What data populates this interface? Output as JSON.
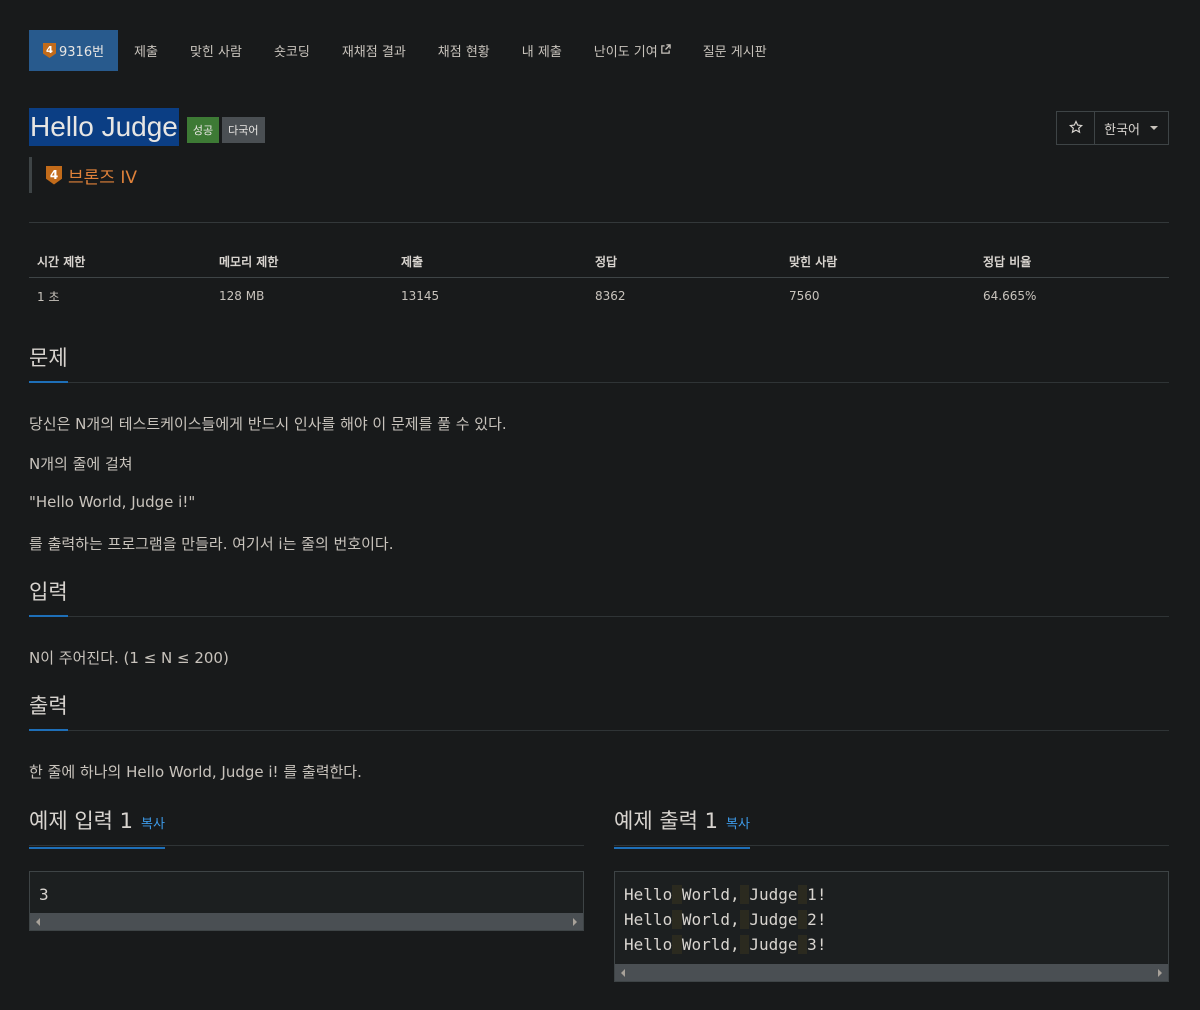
{
  "nav": {
    "problem_tier": "4",
    "problem_id": "9316번",
    "items": [
      "제출",
      "맞힌 사람",
      "숏코딩",
      "재채점 결과",
      "채점 현황",
      "내 제출",
      "난이도 기여",
      "질문 게시판"
    ]
  },
  "problem": {
    "title": "Hello Judge",
    "labels": [
      "성공",
      "다국어"
    ],
    "tier_number": "4",
    "tier_text": "브론즈 IV",
    "language": "한국어"
  },
  "stats": {
    "headers": [
      "시간 제한",
      "메모리 제한",
      "제출",
      "정답",
      "맞힌 사람",
      "정답 비율"
    ],
    "values": [
      "1 초",
      "128 MB",
      "13145",
      "8362",
      "7560",
      "64.665%"
    ]
  },
  "sections": {
    "description": {
      "heading": "문제",
      "lines": [
        "당신은 N개의 테스트케이스들에게 반드시 인사를 해야 이 문제를 풀 수 있다.",
        "N개의 줄에 걸쳐",
        "\"Hello World, Judge i!\"",
        "를 출력하는 프로그램을 만들라. 여기서 i는 줄의 번호이다."
      ]
    },
    "input": {
      "heading": "입력",
      "text": "N이 주어진다. (1 ≤ N ≤ 200)"
    },
    "output": {
      "heading": "출력",
      "text": "한 줄에 하나의 Hello World, Judge i! 를 출력한다."
    }
  },
  "samples": {
    "copy_label": "복사",
    "input": {
      "heading": "예제 입력 1",
      "text": "3"
    },
    "output": {
      "heading": "예제 출력 1",
      "lines": [
        "Hello World, Judge 1!",
        "Hello World, Judge 2!",
        "Hello World, Judge 3!"
      ]
    }
  },
  "colors": {
    "background": "#181a1b",
    "accent": "#1e6fb8",
    "active_tab": "#285a8d",
    "success_label": "#3d7a35",
    "bronze": "#e0823a",
    "copy_link": "#3d9ae8"
  },
  "icons": [
    "star-icon",
    "caret-down-icon",
    "external-link-icon",
    "bronze-tier-icon"
  ]
}
